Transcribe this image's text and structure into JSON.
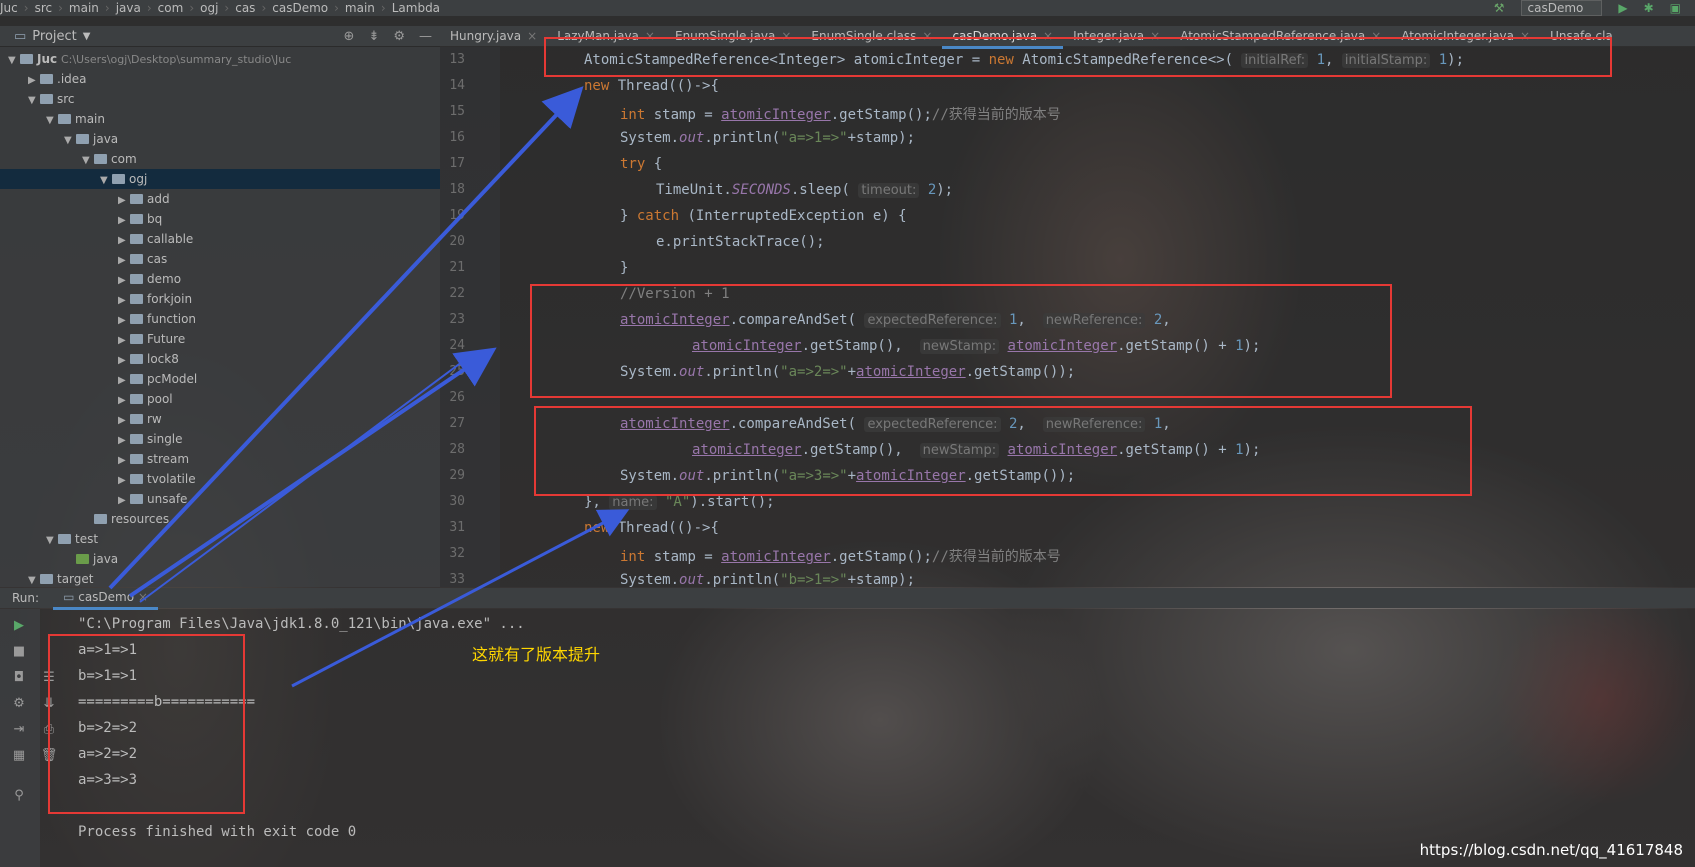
{
  "breadcrumb": [
    "Juc",
    "src",
    "main",
    "java",
    "com",
    "ogj",
    "cas",
    "casDemo",
    "main",
    "Lambda"
  ],
  "run_config": "casDemo",
  "project_panel": {
    "title": "Project",
    "root_name": "Juc",
    "root_path": "C:\\Users\\ogj\\Desktop\\summary_studio\\Juc",
    "items": [
      ".idea",
      "src",
      "main",
      "java",
      "com",
      "ogj",
      "add",
      "bq",
      "callable",
      "cas",
      "demo",
      "forkjoin",
      "function",
      "Future",
      "lock8",
      "pcModel",
      "pool",
      "rw",
      "single",
      "stream",
      "tvolatile",
      "unsafe",
      "resources",
      "test",
      "java",
      "target"
    ]
  },
  "tabs": [
    "Hungry.java",
    "LazyMan.java",
    "EnumSingle.java",
    "EnumSingle.class",
    "casDemo.java",
    "Integer.java",
    "AtomicStampedReference.java",
    "AtomicInteger.java",
    "Unsafe.cla"
  ],
  "line_numbers": [
    "13",
    "14",
    "15",
    "16",
    "17",
    "18",
    "19",
    "20",
    "21",
    "22",
    "23",
    "24",
    "25",
    "26",
    "27",
    "28",
    "29",
    "30",
    "31",
    "32",
    "33"
  ],
  "code": {
    "l13_a": "AtomicStampedReference<Integer> atomicInteger = ",
    "l13_new": "new",
    "l13_b": " AtomicStampedReference<>(",
    "l13_hint1": "initialRef:",
    "l13_v1": "1",
    "l13_hint2": "initialStamp:",
    "l13_v2": "1",
    "l13_end": ");",
    "l14_new": "new",
    "l14_b": " Thread(()->{",
    "l15_int": "int",
    "l15_a": " stamp = ",
    "field": "atomicInteger",
    "l15_b": ".getStamp();",
    "l15_cmt": "//获得当前的版本号",
    "l16_a": "System.",
    "out": "out",
    "l16_b": ".println(",
    "l16_str": "\"a=>1=>\"",
    "l16_c": "+stamp);",
    "l17_try": "try",
    "l17_b": " {",
    "l18_a": "TimeUnit.",
    "l18_static": "SECONDS",
    "l18_b": ".sleep(",
    "l18_hint": "timeout:",
    "l18_v": "2",
    "l18_end": ");",
    "l19_a": "} ",
    "l19_catch": "catch",
    "l19_b": " (InterruptedException e) {",
    "l20": "e.printStackTrace();",
    "l21": "}",
    "l22_cmt": "//Version + 1",
    "l23_b": ".compareAndSet(",
    "l23_hint1": "expectedReference:",
    "l23_v1": "1",
    "l23_hint2": "newReference:",
    "l23_v2": "2",
    "l24_b": ".getStamp(),",
    "l24_hint": "newStamp:",
    "l24_c": ".getStamp() + ",
    "l24_v": "1",
    "l24_end": ");",
    "l25_str": "\"a=>2=>\"",
    "l25_c": ".getStamp());",
    "l27_v1": "2",
    "l27_v2": "1",
    "l29_str": "\"a=>3=>\"",
    "l30_a": "}, ",
    "l30_hint": "name:",
    "l30_str": "\"A\"",
    "l30_b": ").start();",
    "l33_str": "\"b=>1=>\"",
    "l33_c": "+stamp);"
  },
  "run_panel": {
    "label": "Run:",
    "tab": "casDemo",
    "console": [
      "\"C:\\Program Files\\Java\\jdk1.8.0_121\\bin\\java.exe\" ...",
      "a=>1=>1",
      "b=>1=>1",
      "=========b===========",
      "b=>2=>2",
      "a=>2=>2",
      "a=>3=>3",
      "",
      "Process finished with exit code 0"
    ]
  },
  "annotation": "这就有了版本提升",
  "watermark": "https://blog.csdn.net/qq_41617848",
  "colors": {
    "annotation_red": "#e53935",
    "arrow_blue": "#3a5bd9",
    "annotation_text": "#ffd700"
  }
}
